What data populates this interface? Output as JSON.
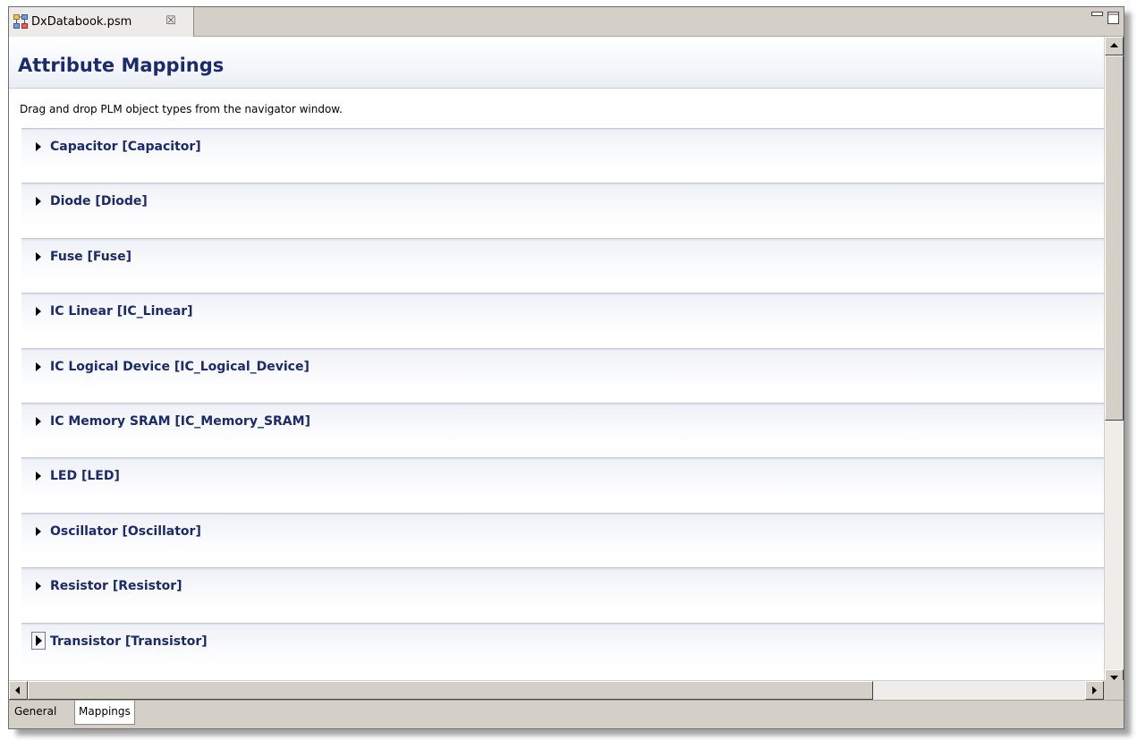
{
  "editor_tab": {
    "title": "DxDatabook.psm",
    "close_symbol": "☒",
    "icon": "psm-file-icon"
  },
  "window_controls": {
    "minimize_icon": "minimize-icon",
    "maximize_icon": "maximize-icon"
  },
  "form": {
    "title": "Attribute Mappings",
    "instructions": "Drag and drop PLM object types from the navigator window."
  },
  "sections": [
    {
      "label": "Capacitor [Capacitor]",
      "expanded": false,
      "focused": false
    },
    {
      "label": "Diode [Diode]",
      "expanded": false,
      "focused": false
    },
    {
      "label": "Fuse [Fuse]",
      "expanded": false,
      "focused": false
    },
    {
      "label": "IC Linear [IC_Linear]",
      "expanded": false,
      "focused": false
    },
    {
      "label": "IC Logical Device [IC_Logical_Device]",
      "expanded": false,
      "focused": false
    },
    {
      "label": "IC Memory SRAM [IC_Memory_SRAM]",
      "expanded": false,
      "focused": false
    },
    {
      "label": "LED [LED]",
      "expanded": false,
      "focused": false
    },
    {
      "label": "Oscillator [Oscillator]",
      "expanded": false,
      "focused": false
    },
    {
      "label": "Resistor [Resistor]",
      "expanded": false,
      "focused": false
    },
    {
      "label": "Transistor [Transistor]",
      "expanded": false,
      "focused": true
    }
  ],
  "page_tabs": [
    {
      "label": "General",
      "active": false
    },
    {
      "label": "Mappings",
      "active": true
    }
  ],
  "colors": {
    "title_text": "#1b2a6b",
    "chrome": "#d4d0c8",
    "section_border": "#c4cad8"
  }
}
